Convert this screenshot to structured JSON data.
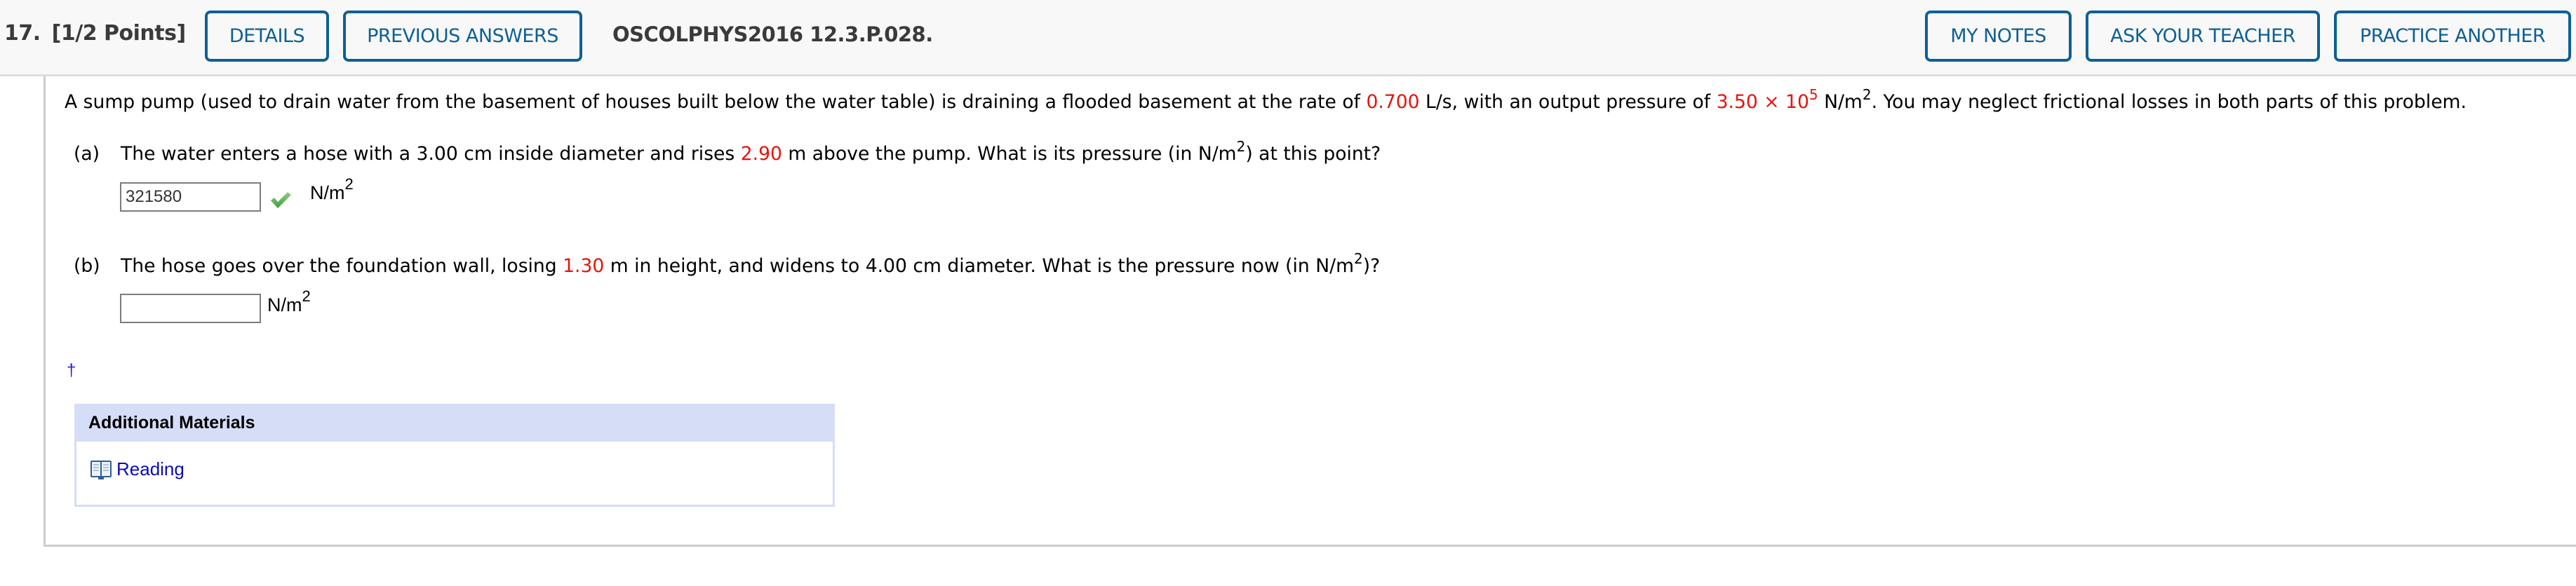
{
  "header": {
    "question_number": "17.",
    "points": "[1/2 Points]",
    "buttons_left": [
      "DETAILS",
      "PREVIOUS ANSWERS"
    ],
    "problem_id": "OSCOLPHYS2016 12.3.P.028.",
    "buttons_right": [
      "MY NOTES",
      "ASK YOUR TEACHER",
      "PRACTICE ANOTHER"
    ]
  },
  "problem": {
    "intro_1": "A sump pump (used to drain water from the basement of houses built below the water table) is draining a flooded basement at the rate of ",
    "rate_value": "0.700",
    "intro_2": " L/s, with an output pressure of ",
    "pressure_value": "3.50 × 10",
    "pressure_exp": "5",
    "intro_3": " N/m",
    "intro_3_exp": "2",
    "intro_4": ". You may neglect frictional losses in both parts of this problem."
  },
  "parts": [
    {
      "label": "(a)",
      "text_1": "The water enters a hose with a 3.00 cm inside diameter and rises ",
      "value": "2.90",
      "text_2": " m above the pump. What is its pressure (in N/m",
      "text_exp": "2",
      "text_3": ") at this point?",
      "answer": "321580",
      "status": "correct",
      "status_icon": "check-icon",
      "unit": "N/m",
      "unit_exp": "2"
    },
    {
      "label": "(b)",
      "text_1": "The hose goes over the foundation wall, losing ",
      "value": "1.30",
      "text_2": " m in height, and widens to 4.00 cm diameter. What is the pressure now (in N/m",
      "text_exp": "2",
      "text_3": ")?",
      "answer": "",
      "unit": "N/m",
      "unit_exp": "2"
    }
  ],
  "footnote_marker": "†",
  "additional_materials": {
    "title": "Additional Materials",
    "items": [
      {
        "label": "Reading",
        "icon": "book-icon"
      }
    ]
  },
  "colors": {
    "accent": "#0e6095",
    "highlight_value": "#e8130c",
    "link": "#0b0bb8",
    "panel_header": "#d6ddf6",
    "correct": "#5cb85c"
  }
}
